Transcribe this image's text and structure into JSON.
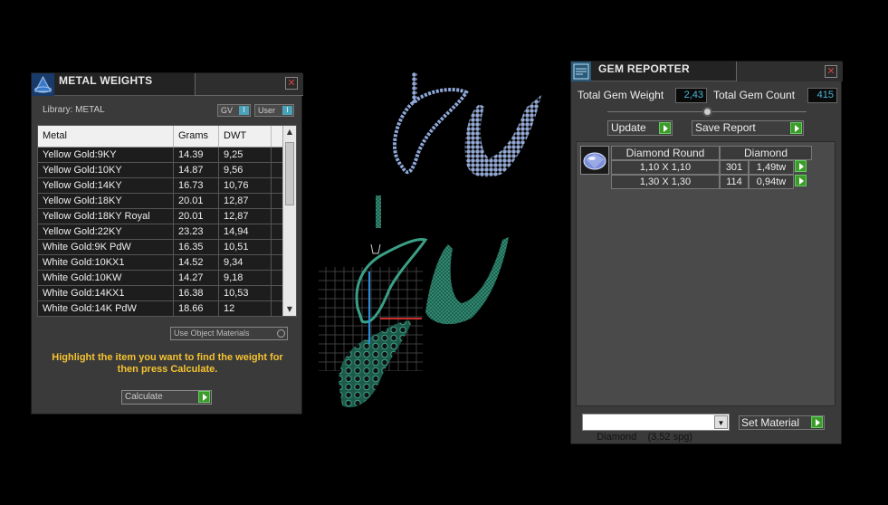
{
  "metal_panel": {
    "title": "METAL WEIGHTS",
    "library_label": "Library: METAL",
    "gv_button": "GV",
    "user_button": "User",
    "indicator": "I",
    "columns": [
      "Metal",
      "Grams",
      "DWT"
    ],
    "rows": [
      [
        "Yellow Gold:9KY",
        "14.39",
        "9,25"
      ],
      [
        "Yellow Gold:10KY",
        "14.87",
        "9,56"
      ],
      [
        "Yellow Gold:14KY",
        "16.73",
        "10,76"
      ],
      [
        "Yellow Gold:18KY",
        "20.01",
        "12,87"
      ],
      [
        "Yellow Gold:18KY Royal",
        "20.01",
        "12,87"
      ],
      [
        "Yellow Gold:22KY",
        "23.23",
        "14,94"
      ],
      [
        "White Gold:9K PdW",
        "16.35",
        "10,51"
      ],
      [
        "White Gold:10KX1",
        "14.52",
        "9,34"
      ],
      [
        "White Gold:10KW",
        "14.27",
        "9,18"
      ],
      [
        "White Gold:14KX1",
        "16.38",
        "10,53"
      ],
      [
        "White Gold:14K PdW",
        "18.66",
        "12"
      ]
    ],
    "use_object_materials": "Use Object Materials",
    "hint": "Highlight the item you want to find the weight for then press Calculate.",
    "calculate_label": "Calculate"
  },
  "gem_panel": {
    "title": "GEM REPORTER",
    "total_weight_label": "Total Gem Weight",
    "total_weight_value": "2,43",
    "total_count_label": "Total Gem Count",
    "total_count_value": "415",
    "update_label": "Update",
    "save_report_label": "Save Report",
    "table_header_shape": "Diamond Round",
    "table_header_material": "Diamond",
    "gems": [
      {
        "size": "1,10 X 1,10",
        "count": "301",
        "weight": "1,49tw"
      },
      {
        "size": "1,30 X 1,30",
        "count": "114",
        "weight": "0,94tw"
      }
    ],
    "material_select": "Diamond    (3,52 spg)",
    "set_material_label": "Set Material"
  },
  "colors": {
    "accent_blue": "#49b5d6",
    "hint_yellow": "#f5c230",
    "go_green": "#3d9b2a",
    "mesh_teal": "#3aa085",
    "gem_blue": "#8fa8d8"
  }
}
